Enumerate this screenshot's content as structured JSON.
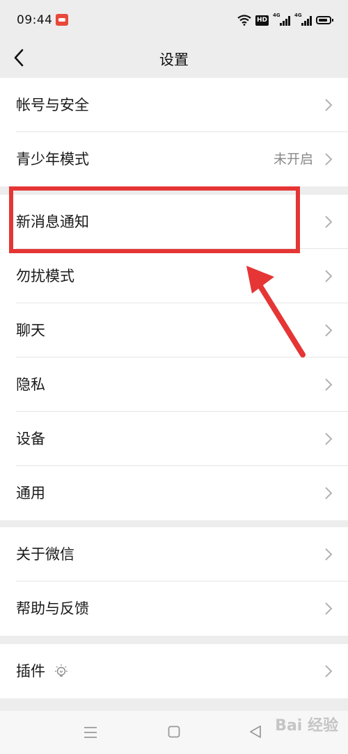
{
  "status_bar": {
    "time": "09:44",
    "hd_label": "HD",
    "network_1": "4G",
    "network_2": "4G"
  },
  "header": {
    "title": "设置",
    "back_icon": "chevron-left-icon"
  },
  "groups": [
    {
      "items": [
        {
          "label": "帐号与安全",
          "value": ""
        },
        {
          "label": "青少年模式",
          "value": "未开启"
        }
      ]
    },
    {
      "items": [
        {
          "label": "新消息通知",
          "value": ""
        },
        {
          "label": "勿扰模式",
          "value": ""
        },
        {
          "label": "聊天",
          "value": ""
        },
        {
          "label": "隐私",
          "value": ""
        },
        {
          "label": "设备",
          "value": ""
        },
        {
          "label": "通用",
          "value": ""
        }
      ]
    },
    {
      "items": [
        {
          "label": "关于微信",
          "value": ""
        },
        {
          "label": "帮助与反馈",
          "value": ""
        }
      ]
    },
    {
      "items": [
        {
          "label": "插件",
          "value": "",
          "icon": "lightbulb-icon"
        }
      ]
    }
  ],
  "annotation": {
    "highlight_color": "#e53535",
    "highlighted_item": "新消息通知"
  },
  "system_nav": {
    "buttons": [
      "menu-icon",
      "home-square-icon",
      "back-triangle-icon"
    ]
  },
  "watermark": "Bai 经验"
}
